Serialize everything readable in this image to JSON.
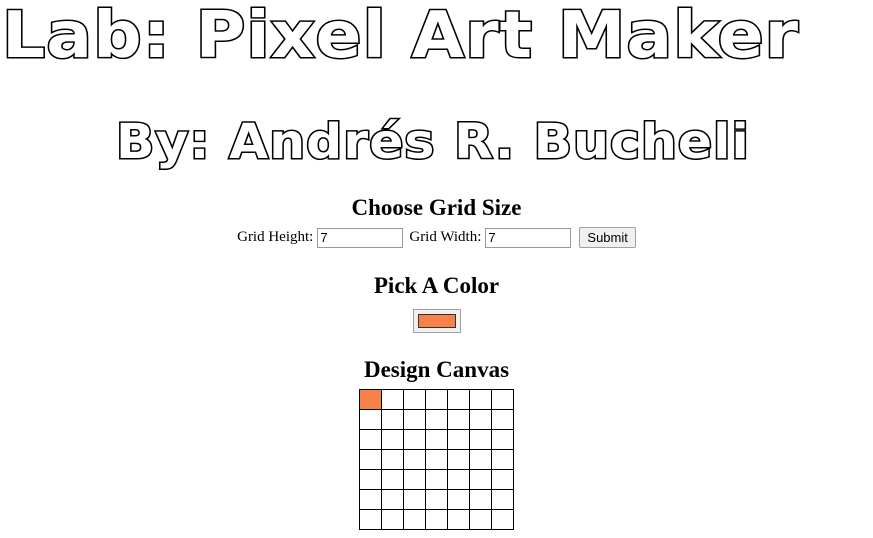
{
  "header": {
    "title": "Lab: Pixel Art Maker",
    "byline": "By: Andrés R. Bucheli"
  },
  "grid_size": {
    "heading": "Choose Grid Size",
    "height_label": "Grid Height:",
    "height_value": "7",
    "width_label": "Grid Width:",
    "width_value": "7",
    "submit_label": "Submit"
  },
  "color_picker": {
    "heading": "Pick A Color",
    "value": "#f6824a"
  },
  "canvas": {
    "heading": "Design Canvas",
    "rows": 7,
    "cols": 7,
    "painted": [
      {
        "row": 0,
        "col": 0,
        "color": "#f6824a"
      }
    ]
  }
}
